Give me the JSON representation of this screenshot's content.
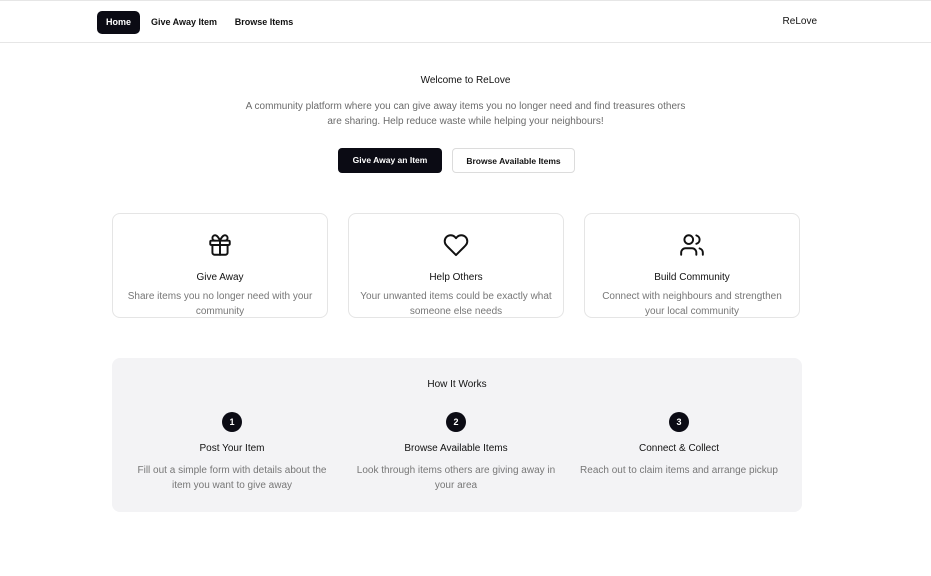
{
  "nav": {
    "home": "Home",
    "give_away": "Give Away Item",
    "browse": "Browse Items",
    "brand": "ReLove"
  },
  "hero": {
    "title": "Welcome to ReLove",
    "description": "A community platform where you can give away items you no longer need and find treasures others are sharing. Help reduce waste while helping your neighbours!",
    "primary_cta": "Give Away an Item",
    "secondary_cta": "Browse Available Items"
  },
  "features": [
    {
      "icon": "gift-icon",
      "title": "Give Away",
      "text": "Share items you no longer need with your community"
    },
    {
      "icon": "heart-icon",
      "title": "Help Others",
      "text": "Your unwanted items could be exactly what someone else needs"
    },
    {
      "icon": "users-icon",
      "title": "Build Community",
      "text": "Connect with neighbours and strengthen your local community"
    }
  ],
  "how": {
    "title": "How It Works",
    "steps": [
      {
        "num": "1",
        "title": "Post Your Item",
        "text": "Fill out a simple form with details about the item you want to give away"
      },
      {
        "num": "2",
        "title": "Browse Available Items",
        "text": "Look through items others are giving away in your area"
      },
      {
        "num": "3",
        "title": "Connect & Collect",
        "text": "Reach out to claim items and arrange pickup"
      }
    ]
  },
  "colors": {
    "primary": "#0b0b14",
    "muted_text": "#777777",
    "section_bg": "#f3f3f5"
  }
}
